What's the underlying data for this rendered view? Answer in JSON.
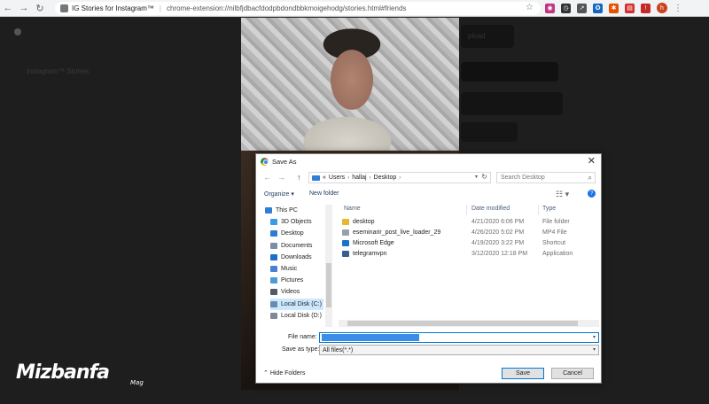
{
  "browser": {
    "tab_title": "IG Stories for Instagram™",
    "url": "chrome-extension://nilbfjdbacfdodpbdondbbkmoigehodg/stories.html#friends",
    "nav": {
      "back": "←",
      "forward": "→",
      "reload": "↻"
    },
    "star": "☆",
    "extensions": [
      {
        "name": "instagram",
        "color": "#c13584",
        "glyph": "◉"
      },
      {
        "name": "clock",
        "color": "#333333",
        "glyph": "◷"
      },
      {
        "name": "arrow",
        "color": "#555555",
        "glyph": "↗"
      },
      {
        "name": "shield",
        "color": "#1565c0",
        "glyph": "✪"
      },
      {
        "name": "settings",
        "color": "#e65100",
        "glyph": "✱"
      },
      {
        "name": "pdf",
        "color": "#d32f2f",
        "glyph": "▤"
      },
      {
        "name": "alert",
        "color": "#c62828",
        "glyph": "!"
      }
    ],
    "profile_initial": "h",
    "menu": "⋮"
  },
  "page": {
    "upload_label": "pload",
    "story_label": "instagram™ Stories"
  },
  "watermark": {
    "logo": "Mizbanfa",
    "sub": "Mag"
  },
  "dialog": {
    "title": "Save As",
    "close": "✕",
    "nav": {
      "back": "←",
      "forward": "→",
      "up": "↑"
    },
    "breadcrumb": [
      "Users",
      "hallaj",
      "Desktop"
    ],
    "breadcrumb_prefix": "«",
    "search_placeholder": "Search Desktop",
    "organize": "Organize ▾",
    "new_folder": "New folder",
    "view": "☷ ▾",
    "help": "?",
    "nav_pane": [
      {
        "label": "This PC",
        "color": "#2f7ed8",
        "selected": false
      },
      {
        "label": "3D Objects",
        "color": "#3c9be3",
        "selected": false
      },
      {
        "label": "Desktop",
        "color": "#2d7dd2",
        "selected": false
      },
      {
        "label": "Documents",
        "color": "#7a8ea8",
        "selected": false
      },
      {
        "label": "Downloads",
        "color": "#1a6fc9",
        "selected": false
      },
      {
        "label": "Music",
        "color": "#4a7fd1",
        "selected": false
      },
      {
        "label": "Pictures",
        "color": "#4d9bd8",
        "selected": false
      },
      {
        "label": "Videos",
        "color": "#555b66",
        "selected": false
      },
      {
        "label": "Local Disk (C:)",
        "color": "#6a8bb0",
        "selected": true
      },
      {
        "label": "Local Disk (D:)",
        "color": "#7d8a99",
        "selected": false
      }
    ],
    "columns": {
      "name": "Name",
      "date": "Date modified",
      "type": "Type"
    },
    "files": [
      {
        "name": "desktop",
        "date": "4/21/2020 6:06 PM",
        "type": "File folder",
        "color": "#e8b631"
      },
      {
        "name": "eseminarir_post_live_loader_29",
        "date": "4/26/2020 5:02 PM",
        "type": "MP4 File",
        "color": "#9aa0a8"
      },
      {
        "name": "Microsoft Edge",
        "date": "4/19/2020 3:22 PM",
        "type": "Shortcut",
        "color": "#1b73c7"
      },
      {
        "name": "telegramvpn",
        "date": "3/12/2020 12:18 PM",
        "type": "Application",
        "color": "#3a5f8f"
      }
    ],
    "file_name_label": "File name:",
    "file_name_value": "",
    "save_as_type_label": "Save as type:",
    "save_as_type_value": "All files(*.*)",
    "hide_folders": "Hide Folders",
    "save": "Save",
    "cancel": "Cancel"
  }
}
